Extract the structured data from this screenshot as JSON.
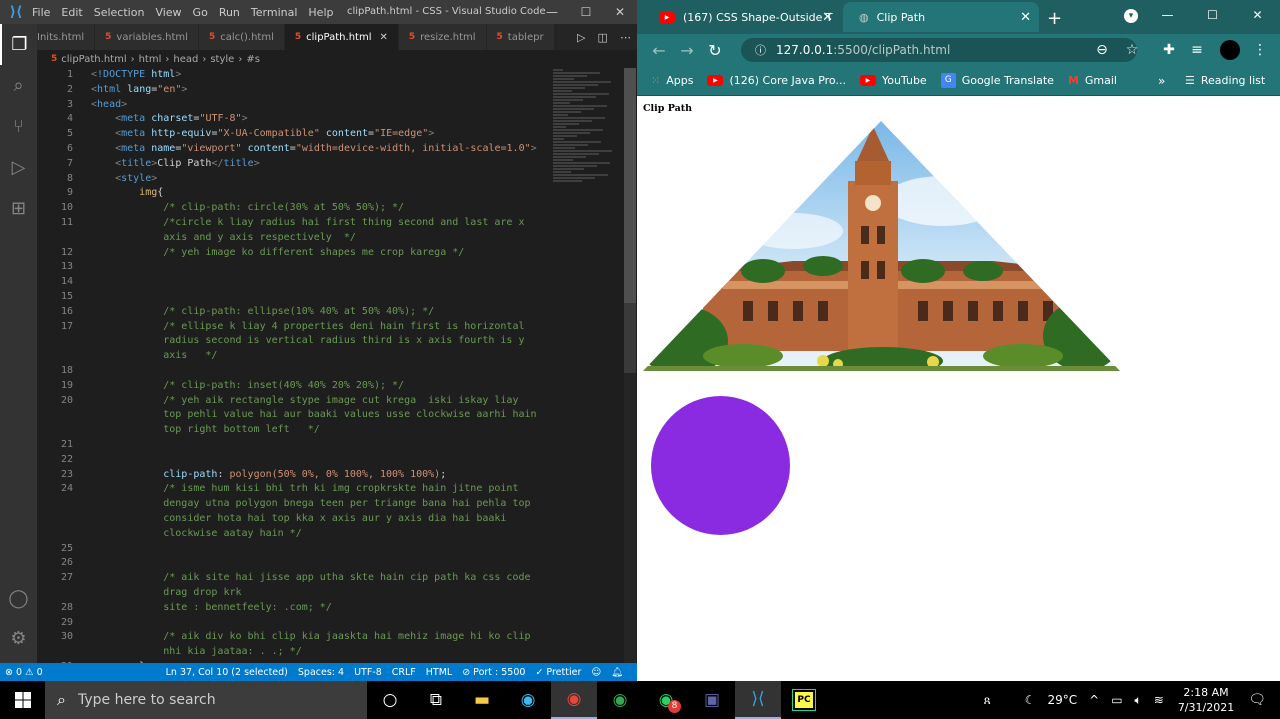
{
  "vscode": {
    "menu": [
      "File",
      "Edit",
      "Selection",
      "View",
      "Go",
      "Run",
      "Terminal",
      "Help"
    ],
    "window_title": "clipPath.html - CSS - Visual Studio Code",
    "tabs": [
      {
        "label": "Inits.html",
        "active": false
      },
      {
        "label": "variables.html",
        "active": false
      },
      {
        "label": "calc().html",
        "active": false
      },
      {
        "label": "clipPath.html",
        "active": true
      },
      {
        "label": "resize.html",
        "active": false
      },
      {
        "label": "tablepr",
        "active": false
      }
    ],
    "breadcrumb": [
      "clipPath.html",
      "html",
      "head",
      "style",
      "#s"
    ],
    "lines": [
      {
        "n": "1",
        "h": "<span class='c-g'>&lt;</span><span class='c-tag'>!DOCTYPE</span> <span class='c-attr'>html</span><span class='c-g'>&gt;</span>"
      },
      {
        "n": "2",
        "h": "<span class='c-g'>&lt;</span><span class='c-tag'>html</span> <span class='c-attr'>lang</span>=<span class='c-str'>\"en\"</span><span class='c-g'>&gt;</span>"
      },
      {
        "n": "3",
        "h": "<span class='c-g'>&lt;</span><span class='c-tag'>head</span><span class='c-g'>&gt;</span>"
      },
      {
        "n": "4",
        "h": "    <span class='c-g'>&lt;</span><span class='c-tag'>meta</span> <span class='c-attr'>charset</span>=<span class='c-str'>\"UTF-8\"</span><span class='c-g'>&gt;</span>"
      },
      {
        "n": "5",
        "h": "    <span class='c-g'>&lt;</span><span class='c-tag'>meta</span> <span class='c-attr'>http-equiv</span>=<span class='c-str'>\"X-UA-Compatible\"</span> <span class='c-attr'>content</span>=<span class='c-str'>\"IE=edge\"</span><span class='c-g'>&gt;</span>"
      },
      {
        "n": "6",
        "h": "    <span class='c-g'>&lt;</span><span class='c-tag'>meta</span> <span class='c-attr'>name</span>=<span class='c-str'>\"viewport\"</span> <span class='c-attr'>content</span>=<span class='c-str'>\"width=device-width, initial-scale=1.0\"</span><span class='c-g'>&gt;</span>"
      },
      {
        "n": "7",
        "h": "    <span class='c-g'>&lt;</span><span class='c-tag'>title</span><span class='c-g'>&gt;</span>Clip Path<span class='c-g'>&lt;/</span><span class='c-tag'>title</span><span class='c-g'>&gt;</span>"
      },
      {
        "n": "8",
        "h": "    <span class='c-g'>&lt;</span><span class='c-tag'>style</span><span class='c-g'>&gt;</span>"
      },
      {
        "n": "9",
        "h": "        <span class='c-sel'>img</span>{"
      },
      {
        "n": "10",
        "h": "            <span class='c-com'>/* clip-path: circle(30% at 50% 50%); */</span>"
      },
      {
        "n": "11",
        "h": "            <span class='c-com'>/*circle k liay radius hai first thing second and last are x</span>"
      },
      {
        "n": "",
        "h": "            <span class='c-com'>axis and y axis respectively  */</span>"
      },
      {
        "n": "12",
        "h": "            <span class='c-com'>/* yeh image ko different shapes me crop karega */</span>"
      },
      {
        "n": "13",
        "h": ""
      },
      {
        "n": "14",
        "h": ""
      },
      {
        "n": "15",
        "h": ""
      },
      {
        "n": "16",
        "h": "            <span class='c-com'>/* clip-path: ellipse(10% 40% at 50% 40%); */</span>"
      },
      {
        "n": "17",
        "h": "            <span class='c-com'>/* ellipse k liay 4 properties deni hain first is horizontal</span>"
      },
      {
        "n": "",
        "h": "            <span class='c-com'>radius second is vertical radius third is x axis fourth is y</span>"
      },
      {
        "n": "",
        "h": "            <span class='c-com'>axis   */</span>"
      },
      {
        "n": "18",
        "h": ""
      },
      {
        "n": "19",
        "h": "            <span class='c-com'>/* clip-path: inset(40% 40% 20% 20%); */</span>"
      },
      {
        "n": "20",
        "h": "            <span class='c-com'>/* yeh aik rectangle stype image cut krega  iski iskay liay</span>"
      },
      {
        "n": "",
        "h": "            <span class='c-com'>top pehli value hai aur baaki values usse clockwise aarhi hain</span>"
      },
      {
        "n": "",
        "h": "            <span class='c-com'>top right bottom left   */</span>"
      },
      {
        "n": "21",
        "h": ""
      },
      {
        "n": "22",
        "h": ""
      },
      {
        "n": "23",
        "h": "            <span class='c-prop'>clip-path</span>: <span class='c-val'>polygon(50% 0%, 0% 100%, 100% 100%)</span>;"
      },
      {
        "n": "24",
        "h": "            <span class='c-com'>/* isme hum kisi bhi trh ki img cropkrskte hain jitne point</span>"
      },
      {
        "n": "",
        "h": "            <span class='c-com'>dengay utna polygon bnega teen per triange bana hai pehla top</span>"
      },
      {
        "n": "",
        "h": "            <span class='c-com'>consider hota hai top kka x axis aur y axis dia hai baaki</span>"
      },
      {
        "n": "",
        "h": "            <span class='c-com'>clockwise aatay hain */</span>"
      },
      {
        "n": "25",
        "h": ""
      },
      {
        "n": "26",
        "h": ""
      },
      {
        "n": "27",
        "h": "            <span class='c-com'>/* aik site hai jisse app utha skte hain cip path ka css code</span>"
      },
      {
        "n": "",
        "h": "            <span class='c-com'>drag drop krk</span>"
      },
      {
        "n": "28",
        "h": "            <span class='c-com'>site : bennetfeely: .com; */</span>"
      },
      {
        "n": "29",
        "h": ""
      },
      {
        "n": "30",
        "h": "            <span class='c-com'>/* aik div ko bhi clip kia jaaskta hai mehiz image hi ko clip</span>"
      },
      {
        "n": "",
        "h": "            <span class='c-com'>nhi kia jaataa: . .; */</span>"
      },
      {
        "n": "31",
        "h": "        }"
      }
    ],
    "status": {
      "errors": "⊗ 0 ⚠ 0",
      "position": "Ln 37, Col 10 (2 selected)",
      "spaces": "Spaces: 4",
      "encoding": "UTF-8",
      "eol": "CRLF",
      "language": "HTML",
      "port": "⊘ Port : 5500",
      "prettier": "✓ Prettier"
    }
  },
  "chrome": {
    "tabs": [
      {
        "label": "(167) CSS Shape-Outside T",
        "active": false
      },
      {
        "label": "Clip Path",
        "active": true
      }
    ],
    "url_host": "127.0.0.1",
    "url_path": ":5500/clipPath.html",
    "bookmarks": [
      {
        "label": "Apps",
        "icon": "apps-icon"
      },
      {
        "label": "(126) Core Java Pro...",
        "icon": "youtube-icon"
      },
      {
        "label": "YouTube",
        "icon": "youtube-icon"
      },
      {
        "label": "Google Translate",
        "icon": "translate-icon"
      },
      {
        "label": "Gmail",
        "icon": "gmail-icon"
      }
    ],
    "reading_list": "Reading list",
    "page": {
      "heading": "Clip Path",
      "circle_color": "#8a2be2"
    }
  },
  "taskbar": {
    "search_placeholder": "Type here to search",
    "weather": "29°C",
    "time": "2:18 AM",
    "date": "7/31/2021",
    "whatsapp_badge": "8"
  }
}
